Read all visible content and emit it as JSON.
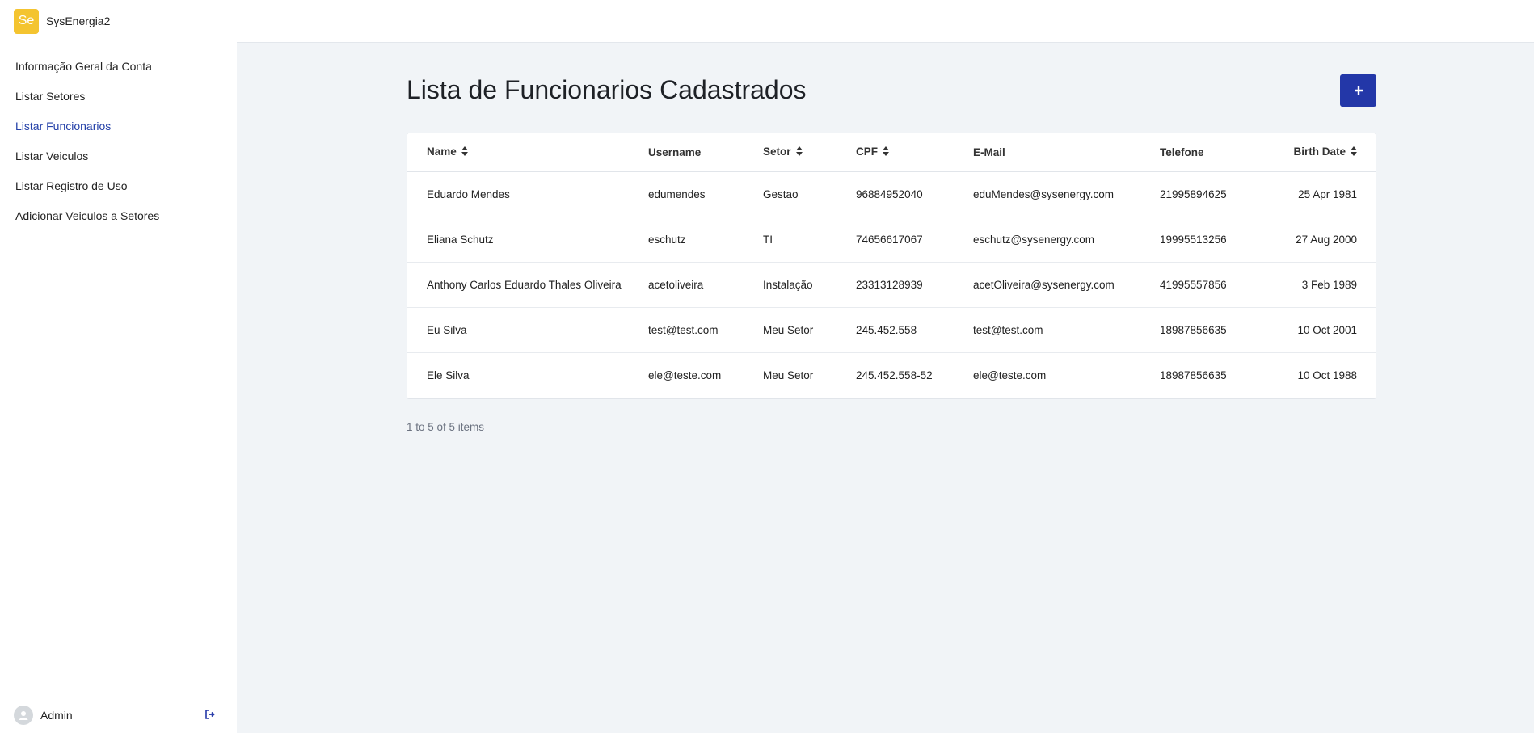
{
  "brand": {
    "logo_text": "Se",
    "name": "SysEnergia2"
  },
  "nav": [
    {
      "label": "Informação Geral da Conta",
      "active": false
    },
    {
      "label": "Listar Setores",
      "active": false
    },
    {
      "label": "Listar Funcionarios",
      "active": true
    },
    {
      "label": "Listar Veiculos",
      "active": false
    },
    {
      "label": "Listar Registro de Uso",
      "active": false
    },
    {
      "label": "Adicionar Veiculos a Setores",
      "active": false
    }
  ],
  "user": {
    "name": "Admin"
  },
  "page": {
    "title": "Lista de Funcionarios Cadastrados",
    "add_button_label": "+",
    "footer": "1 to 5 of 5 items"
  },
  "table": {
    "headers": {
      "name": "Name",
      "username": "Username",
      "setor": "Setor",
      "cpf": "CPF",
      "email": "E-Mail",
      "telefone": "Telefone",
      "birth": "Birth Date"
    },
    "rows": [
      {
        "name": "Eduardo Mendes",
        "username": "edumendes",
        "setor": "Gestao",
        "cpf": "96884952040",
        "email": "eduMendes@sysenergy.com",
        "telefone": "21995894625",
        "birth": "25 Apr 1981"
      },
      {
        "name": "Eliana Schutz",
        "username": "eschutz",
        "setor": "TI",
        "cpf": "74656617067",
        "email": "eschutz@sysenergy.com",
        "telefone": "19995513256",
        "birth": "27 Aug 2000"
      },
      {
        "name": "Anthony Carlos Eduardo Thales Oliveira",
        "username": "acetoliveira",
        "setor": "Instalação",
        "cpf": "23313128939",
        "email": "acetOliveira@sysenergy.com",
        "telefone": "41995557856",
        "birth": "3 Feb 1989"
      },
      {
        "name": "Eu Silva",
        "username": "test@test.com",
        "setor": "Meu Setor",
        "cpf": "245.452.558",
        "email": "test@test.com",
        "telefone": "18987856635",
        "birth": "10 Oct 2001"
      },
      {
        "name": "Ele Silva",
        "username": "ele@teste.com",
        "setor": "Meu Setor",
        "cpf": "245.452.558-52",
        "email": "ele@teste.com",
        "telefone": "18987856635",
        "birth": "10 Oct 1988"
      }
    ]
  },
  "colors": {
    "accent": "#2337a8",
    "active_nav": "#2440a8",
    "logo_bg": "#f4c430",
    "background": "#f1f4f7"
  },
  "icons": {
    "sort": "sort-icon",
    "add": "plus-icon",
    "logout": "logout-icon",
    "avatar": "user-avatar-icon"
  }
}
